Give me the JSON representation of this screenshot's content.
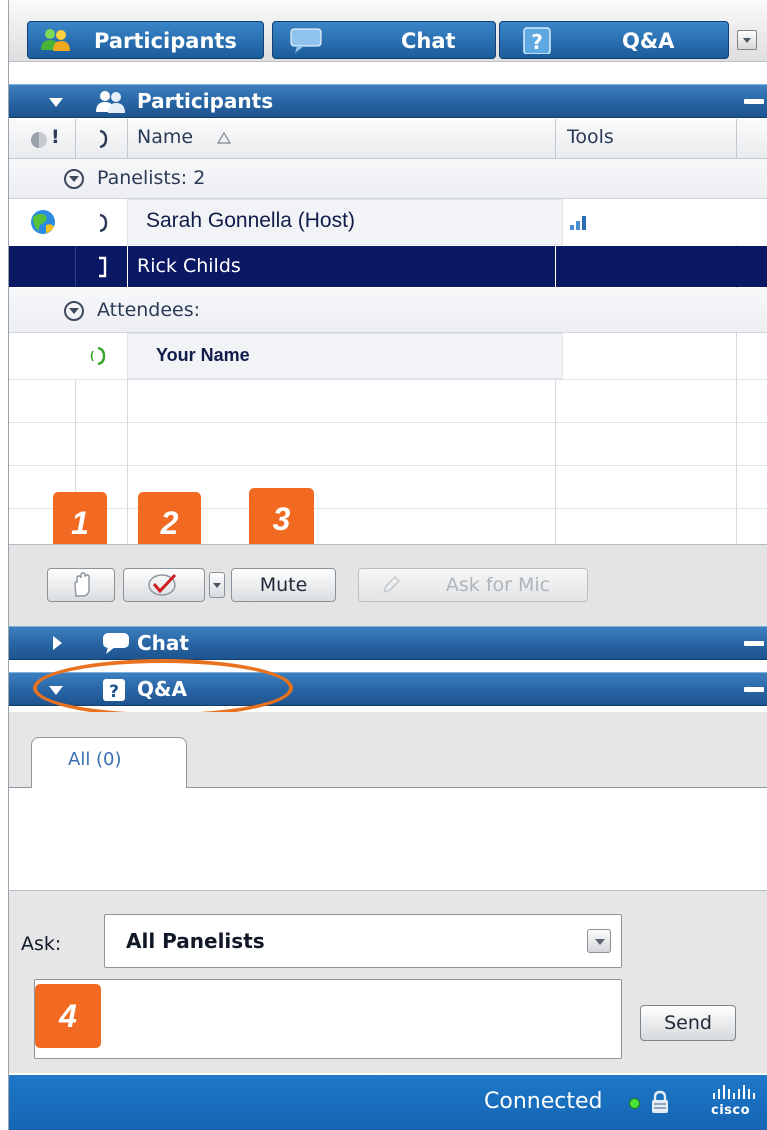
{
  "tabs": [
    {
      "label": "Participants",
      "icon": "participants-icon"
    },
    {
      "label": "Chat",
      "icon": "chat-bubble-icon"
    },
    {
      "label": "Q&A",
      "icon": "question-icon"
    }
  ],
  "participants_panel": {
    "title": "Participants",
    "columns": {
      "status": "!",
      "name": "Name",
      "tools": "Tools"
    },
    "groups": [
      {
        "label": "Panelists: 2"
      },
      {
        "label": "Attendees:"
      }
    ],
    "rows": [
      {
        "name": "Sarah Gonnella (Host)",
        "role": "host",
        "selected": false
      },
      {
        "name": "Rick Childs",
        "role": "panelist",
        "selected": true
      },
      {
        "name": "Your Name",
        "role": "attendee",
        "selected": false
      }
    ],
    "toolbar": {
      "raise_hand_icon": "raise-hand-icon",
      "feedback_icon": "feedback-checkmark-icon",
      "mute_label": "Mute",
      "ask_for_mic_label": "Ask for Mic"
    }
  },
  "callouts": [
    "1",
    "2",
    "3",
    "4"
  ],
  "chat_panel": {
    "title": "Chat"
  },
  "qa_panel": {
    "title": "Q&A",
    "tab_label": "All (0)",
    "ask_label": "Ask:",
    "ask_target": "All Panelists",
    "input_value": "",
    "send_label": "Send"
  },
  "status_bar": {
    "status_text": "Connected",
    "status_color": "#49e23a",
    "brand": "cisco"
  },
  "colors": {
    "header_blue": "#2864a3",
    "selection_navy": "#0a1763",
    "callout_orange": "#f26a21",
    "status_blue": "#1565b3"
  }
}
